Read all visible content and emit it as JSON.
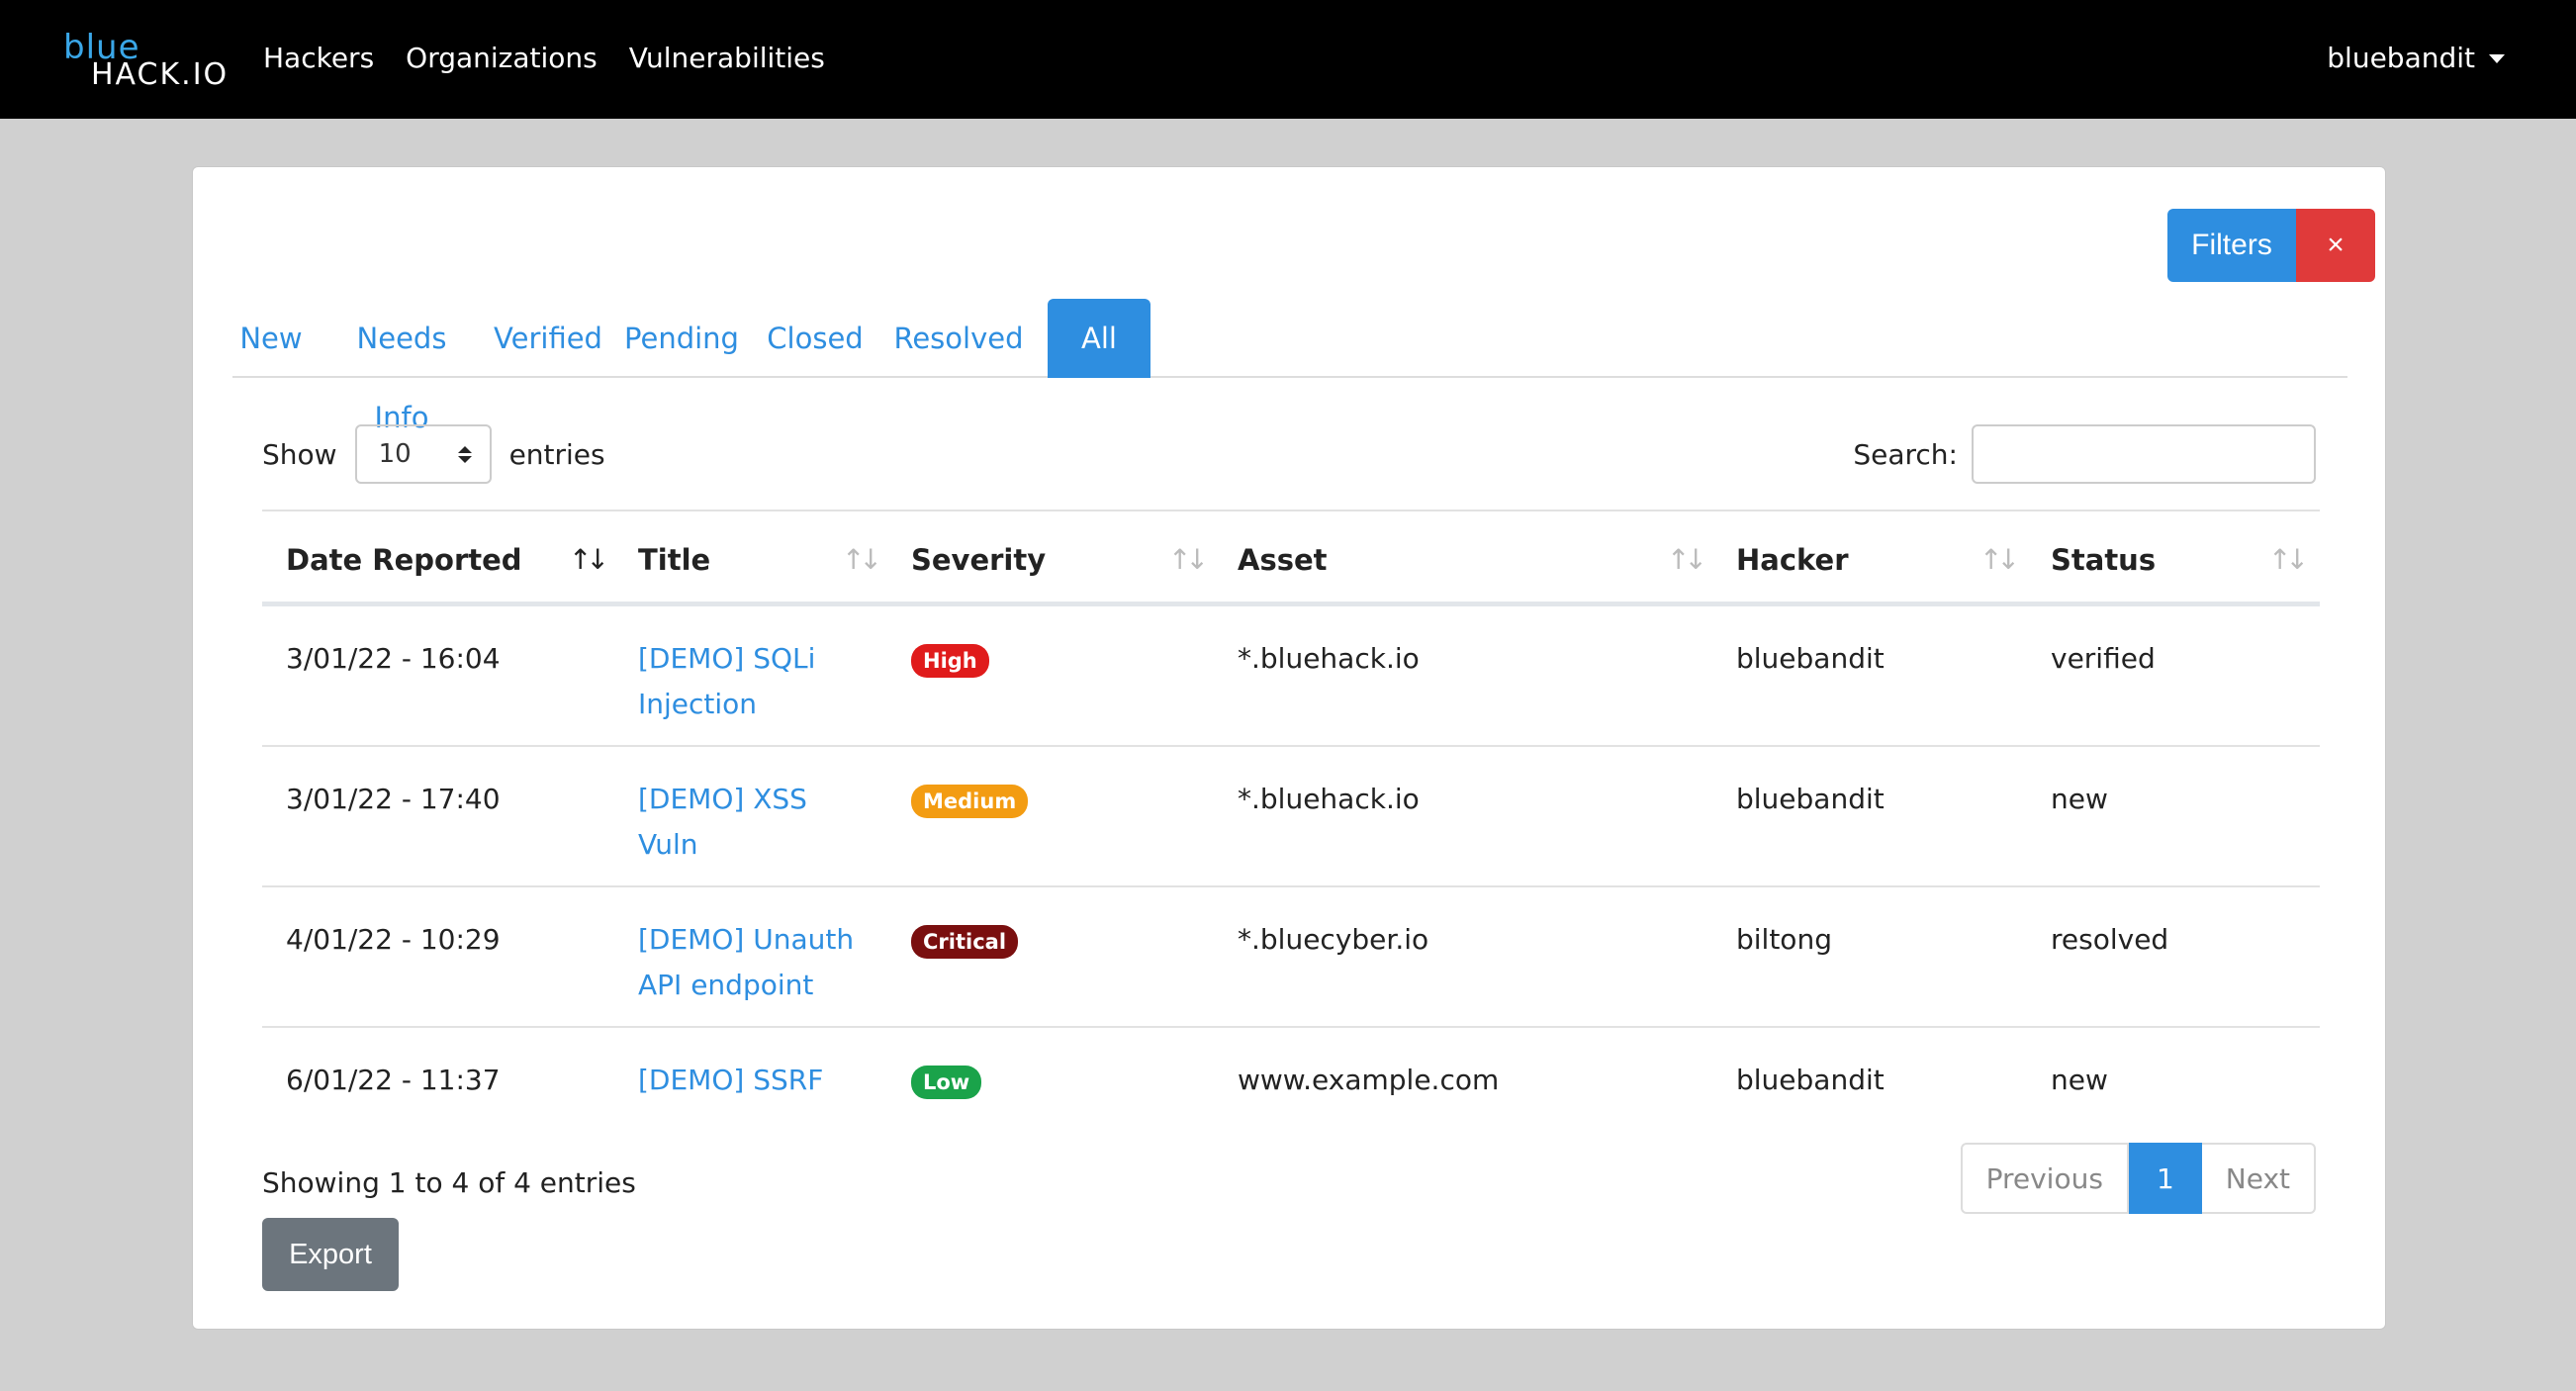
{
  "brand": {
    "line1": "blue",
    "line2": "HACK.IO"
  },
  "nav": {
    "links": [
      "Hackers",
      "Organizations",
      "Vulnerabilities"
    ],
    "user": "bluebandit"
  },
  "filters": {
    "label": "Filters",
    "clear": "×"
  },
  "tabs": [
    "New",
    "Needs Info",
    "Verified",
    "Pending",
    "Closed",
    "Resolved",
    "All"
  ],
  "active_tab": "All",
  "length": {
    "show": "Show",
    "value": "10",
    "entries": "entries"
  },
  "search": {
    "label": "Search:",
    "value": ""
  },
  "table": {
    "columns": [
      "Date Reported",
      "Title",
      "Severity",
      "Asset",
      "Hacker",
      "Status"
    ],
    "rows": [
      {
        "date": "3/01/22 - 16:04",
        "title1": "[DEMO] SQLi",
        "title2": "Injection",
        "severity": "High",
        "asset": "*.bluehack.io",
        "hacker": "bluebandit",
        "status": "verified"
      },
      {
        "date": "3/01/22 - 17:40",
        "title1": "[DEMO] XSS",
        "title2": "Vuln",
        "severity": "Medium",
        "asset": "*.bluehack.io",
        "hacker": "bluebandit",
        "status": "new"
      },
      {
        "date": "4/01/22 - 10:29",
        "title1": "[DEMO] Unauth",
        "title2": "API endpoint",
        "severity": "Critical",
        "asset": "*.bluecyber.io",
        "hacker": "biltong",
        "status": "resolved"
      },
      {
        "date": "6/01/22 - 11:37",
        "title1": "[DEMO] SSRF",
        "title2": "",
        "severity": "Low",
        "asset": "www.example.com",
        "hacker": "bluebandit",
        "status": "new"
      }
    ]
  },
  "severity_colors": {
    "High": "#e01b1b",
    "Medium": "#f39c12",
    "Critical": "#7a0f0f",
    "Low": "#1aa34a"
  },
  "info": "Showing 1 to 4 of 4 entries",
  "pager": {
    "previous": "Previous",
    "page": "1",
    "next": "Next"
  },
  "export": "Export"
}
